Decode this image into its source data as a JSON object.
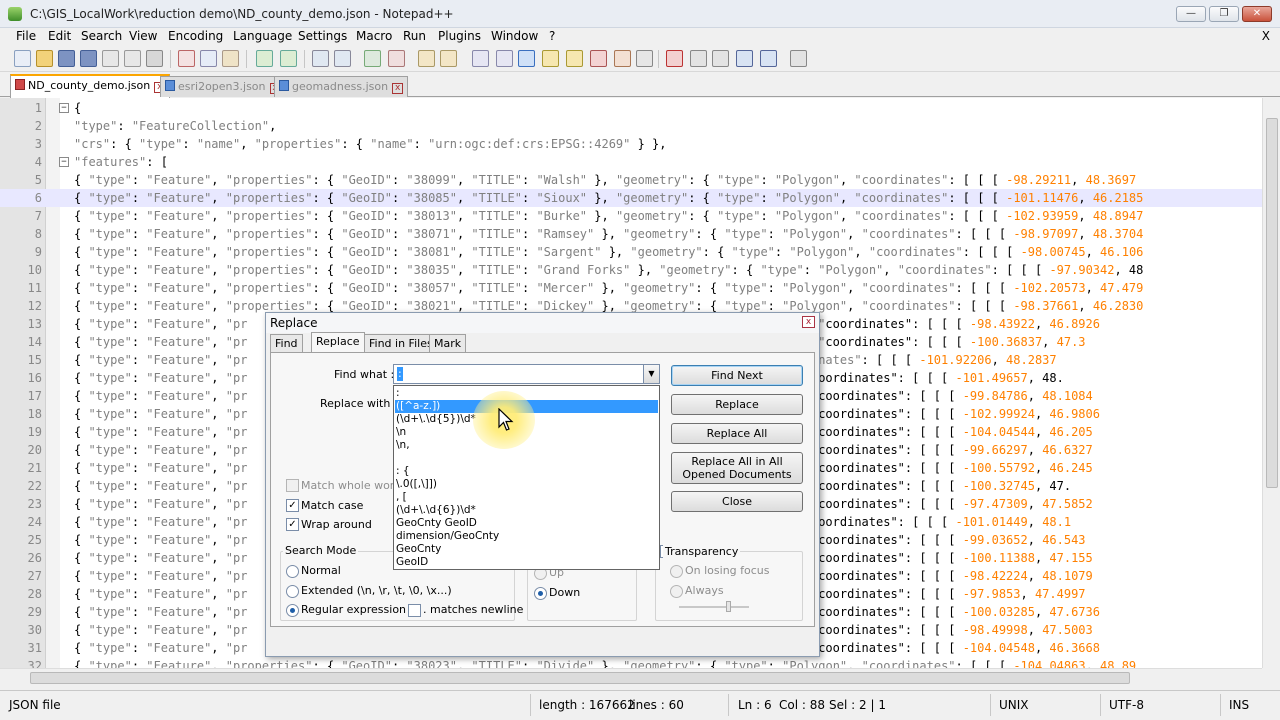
{
  "window": {
    "title": "C:\\GIS_LocalWork\\reduction demo\\ND_county_demo.json - Notepad++",
    "minimize_glyph": "—",
    "restore_glyph": "❐",
    "close_glyph": "✕"
  },
  "menu": {
    "items": [
      "File",
      "Edit",
      "Search",
      "View",
      "Encoding",
      "Language",
      "Settings",
      "Macro",
      "Run",
      "Plugins",
      "Window",
      "?"
    ],
    "close_glyph": "X"
  },
  "tabs": [
    {
      "label": "ND_county_demo.json",
      "active": true,
      "icon": "file-unsaved-icon"
    },
    {
      "label": "esri2open3.json",
      "active": false,
      "icon": "file-icon"
    },
    {
      "label": "geomadness.json",
      "active": false,
      "icon": "file-icon"
    }
  ],
  "editor": {
    "current_line": 6,
    "lines": [
      {
        "n": "1",
        "fold": "minus",
        "text": "{"
      },
      {
        "n": "2",
        "text": "\"type\": \"FeatureCollection\","
      },
      {
        "n": "3",
        "text": "\"crs\": { \"type\": \"name\", \"properties\": { \"name\": \"urn:ogc:def:crs:EPSG::4269\" } },"
      },
      {
        "n": "4",
        "fold": "minus",
        "text": "\"features\": ["
      },
      {
        "n": "5",
        "text": "{ \"type\": \"Feature\", \"properties\": { \"GeoID\": \"38099\", \"TITLE\": \"Walsh\" }, \"geometry\": { \"type\": \"Polygon\", \"coordinates\": [ [ [ -98.29211, 48.3697"
      },
      {
        "n": "6",
        "text": "{ \"type\": \"Feature\", \"properties\": { \"GeoID\": \"38085\", \"TITLE\": \"Sioux\" }, \"geometry\": { \"type\": \"Polygon\", \"coordinates\": [ [ [ -101.11476, 46.2185"
      },
      {
        "n": "7",
        "text": "{ \"type\": \"Feature\", \"properties\": { \"GeoID\": \"38013\", \"TITLE\": \"Burke\" }, \"geometry\": { \"type\": \"Polygon\", \"coordinates\": [ [ [ -102.93959, 48.8947"
      },
      {
        "n": "8",
        "text": "{ \"type\": \"Feature\", \"properties\": { \"GeoID\": \"38071\", \"TITLE\": \"Ramsey\" }, \"geometry\": { \"type\": \"Polygon\", \"coordinates\": [ [ [ -98.97097, 48.3704"
      },
      {
        "n": "9",
        "text": "{ \"type\": \"Feature\", \"properties\": { \"GeoID\": \"38081\", \"TITLE\": \"Sargent\" }, \"geometry\": { \"type\": \"Polygon\", \"coordinates\": [ [ [ -98.00745, 46.106"
      },
      {
        "n": "10",
        "text": "{ \"type\": \"Feature\", \"properties\": { \"GeoID\": \"38035\", \"TITLE\": \"Grand Forks\" }, \"geometry\": { \"type\": \"Polygon\", \"coordinates\": [ [ [ -97.90342, 48"
      },
      {
        "n": "11",
        "text": "{ \"type\": \"Feature\", \"properties\": { \"GeoID\": \"38057\", \"TITLE\": \"Mercer\" }, \"geometry\": { \"type\": \"Polygon\", \"coordinates\": [ [ [ -102.20573, 47.479"
      },
      {
        "n": "12",
        "text": "{ \"type\": \"Feature\", \"properties\": { \"GeoID\": \"38021\", \"TITLE\": \"Dickey\" }, \"geometry\": { \"type\": \"Polygon\", \"coordinates\": [ [ [ -98.37661, 46.2830"
      },
      {
        "n": "13",
        "text": "{ \"type\": \"Feature\", \"pr                                                            \"type\": \"Polygon\", \"coordinates\": [ [ [ -98.43922, 46.8926"
      },
      {
        "n": "14",
        "text": "{ \"type\": \"Feature\", \"pr                                                          { \"type\": \"Polygon\", \"coordinates\": [ [ [ -100.36837, 47.3"
      },
      {
        "n": "15",
        "text": "{ \"type\": \"Feature\", \"pr                                                         e\": \"Polygon\", \"coordinates\": [ [ [ -101.92206, 48.2837"
      },
      {
        "n": "16",
        "text": "{ \"type\": \"Feature\", \"pr                                                          \"type\": \"Polygon\", \"coordinates\": [ [ [ -101.49657, 48."
      },
      {
        "n": "17",
        "text": "{ \"type\": \"Feature\", \"pr                                                           \"type\": \"Polygon\", \"coordinates\": [ [ [ -99.84786, 48.1084"
      },
      {
        "n": "18",
        "text": "{ \"type\": \"Feature\", \"pr                                                           \"type\": \"Polygon\", \"coordinates\": [ [ [ -102.99924, 46.9806"
      },
      {
        "n": "19",
        "text": "{ \"type\": \"Feature\", \"pr                                                           \"type\": \"Polygon\", \"coordinates\": [ [ [ -104.04544, 46.205"
      },
      {
        "n": "20",
        "text": "{ \"type\": \"Feature\", \"pr                                                           \"type\": \"Polygon\", \"coordinates\": [ [ [ -99.66297, 46.6327"
      },
      {
        "n": "21",
        "text": "{ \"type\": \"Feature\", \"pr                                                           \"type\": \"Polygon\", \"coordinates\": [ [ [ -100.55792, 46.245"
      },
      {
        "n": "22",
        "text": "{ \"type\": \"Feature\", \"pr                                                         { \"type\": \"Polygon\", \"coordinates\": [ [ [ -100.32745, 47."
      },
      {
        "n": "23",
        "text": "{ \"type\": \"Feature\", \"pr                                                           \"type\": \"Polygon\", \"coordinates\": [ [ [ -97.47309, 47.5852"
      },
      {
        "n": "24",
        "text": "{ \"type\": \"Feature\", \"pr                                                          \"type\": \"Polygon\", \"coordinates\": [ [ [ -101.01449, 48.1"
      },
      {
        "n": "25",
        "text": "{ \"type\": \"Feature\", \"pr                                                           \"type\": \"Polygon\", \"coordinates\": [ [ [ -99.03652, 46.543"
      },
      {
        "n": "26",
        "text": "{ \"type\": \"Feature\", \"pr                                                           \"type\": \"Polygon\", \"coordinates\": [ [ [ -100.11388, 47.155"
      },
      {
        "n": "27",
        "text": "{ \"type\": \"Feature\", \"pr                                                           \"type\": \"Polygon\", \"coordinates\": [ [ [ -98.42224, 48.1079"
      },
      {
        "n": "28",
        "text": "{ \"type\": \"Feature\", \"pr                                                           \"type\": \"Polygon\", \"coordinates\": [ [ [ -97.9853, 47.4997"
      },
      {
        "n": "29",
        "text": "{ \"type\": \"Feature\", \"pr                                                           \"type\": \"Polygon\", \"coordinates\": [ [ [ -100.03285, 47.6736"
      },
      {
        "n": "30",
        "text": "{ \"type\": \"Feature\", \"pr                                                           \"type\": \"Polygon\", \"coordinates\": [ [ [ -98.49998, 47.5003"
      },
      {
        "n": "31",
        "text": "{ \"type\": \"Feature\", \"pr                                                           \"type\": \"Polygon\", \"coordinates\": [ [ [ -104.04548, 46.3668"
      },
      {
        "n": "32",
        "text": "{ \"type\": \"Feature\", \"properties\": { \"GeoID\": \"38023\", \"TITLE\": \"Divide\" }, \"geometry\": { \"type\": \"Polygon\", \"coordinates\": [ [ [ -104.04863, 48.89"
      }
    ]
  },
  "dialog": {
    "title": "Replace",
    "close_glyph": "x",
    "tabs": [
      "Find",
      "Replace",
      "Find in Files",
      "Mark"
    ],
    "find_what_label": "Find what :",
    "find_what_value": ":",
    "replace_with_label": "Replace with :",
    "buttons": {
      "find_next": "Find Next",
      "replace": "Replace",
      "replace_all": "Replace All",
      "replace_all_opened": "Replace All in All Opened Documents",
      "close": "Close"
    },
    "options": {
      "match_whole_word": {
        "label": "Match whole word o",
        "checked": false,
        "disabled": true
      },
      "match_case": {
        "label": "Match case",
        "checked": true
      },
      "wrap_around": {
        "label": "Wrap around",
        "checked": true
      }
    },
    "search_mode": {
      "title": "Search Mode",
      "normal": "Normal",
      "extended": "Extended (\\n, \\r, \\t, \\0, \\x...)",
      "regex": "Regular expression",
      "matches_newline": ". matches newline",
      "selected": "regex"
    },
    "direction": {
      "up": "Up",
      "down": "Down",
      "selected": "down"
    },
    "transparency": {
      "title": "Transparency",
      "on_losing_focus": "On losing focus",
      "always": "Always"
    },
    "history_dropdown": [
      ":",
      "([^a-z.])",
      "(\\d+\\.\\d{5})\\d*",
      "\\n",
      "\\n,",
      "",
      ": {",
      "\\.0([,\\]])",
      ", [",
      "(\\d+\\.\\d{6})\\d*",
      "GeoCnty GeoID",
      "dimension/GeoCnty",
      "GeoCnty",
      "GeoID"
    ],
    "history_selected_index": 1
  },
  "status": {
    "file_type": "JSON file",
    "length": "length : 167662",
    "lines": "lines : 60",
    "ln": "Ln : 6",
    "col": "Col : 88",
    "sel": "Sel : 2 | 1",
    "eol": "UNIX",
    "encoding": "UTF-8",
    "mode": "INS"
  },
  "colors": {
    "string": "#808080",
    "number": "#ff8000",
    "current_line": "#e8e8ff",
    "selection": "#3399ff",
    "active_tab_accent": "#fba500"
  }
}
